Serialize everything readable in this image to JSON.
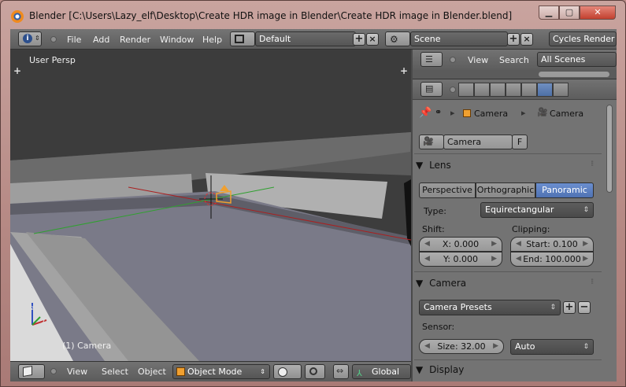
{
  "window": {
    "title": "Blender [C:\\Users\\Lazy_elf\\Desktop\\Create HDR image in Blender\\Create HDR image in Blender.blend]",
    "min_label": "▁",
    "max_label": "▢",
    "close_label": "✕"
  },
  "topbar": {
    "menus": [
      "File",
      "Add",
      "Render",
      "Window",
      "Help"
    ],
    "layout": "Default",
    "scene": "Scene",
    "engine": "Cycles Render"
  },
  "viewport": {
    "label": "User Persp",
    "object_label": "(1) Camera",
    "axis_labels": {
      "x": "x",
      "y": "y",
      "z": "z"
    }
  },
  "viewport_header": {
    "menus": [
      "View",
      "Select",
      "Object"
    ],
    "mode": "Object Mode",
    "orientation": "Global"
  },
  "outliner": {
    "menus": [
      "View",
      "Search"
    ],
    "filter": "All Scenes"
  },
  "properties": {
    "breadcrumb": {
      "object": "Camera",
      "data": "Camera"
    },
    "datablock": {
      "name": "Camera",
      "fake_user": "F"
    },
    "lens": {
      "heading": "Lens",
      "projection_options": [
        "Perspective",
        "Orthographic",
        "Panoramic"
      ],
      "selected": "Panoramic",
      "type_label": "Type:",
      "type_value": "Equirectangular",
      "shift_label": "Shift:",
      "shift_x": "X: 0.000",
      "shift_y": "Y: 0.000",
      "clipping_label": "Clipping:",
      "clip_start": "Start: 0.100",
      "clip_end": "End: 100.000"
    },
    "camera": {
      "heading": "Camera",
      "presets": "Camera Presets",
      "sensor_label": "Sensor:",
      "sensor_size": "Size: 32.00",
      "sensor_fit": "Auto"
    },
    "display": {
      "heading": "Display"
    }
  },
  "colors": {
    "accent": "#5577bb",
    "title_gradient": "#b58883",
    "camera_orange": "#f0a030"
  }
}
